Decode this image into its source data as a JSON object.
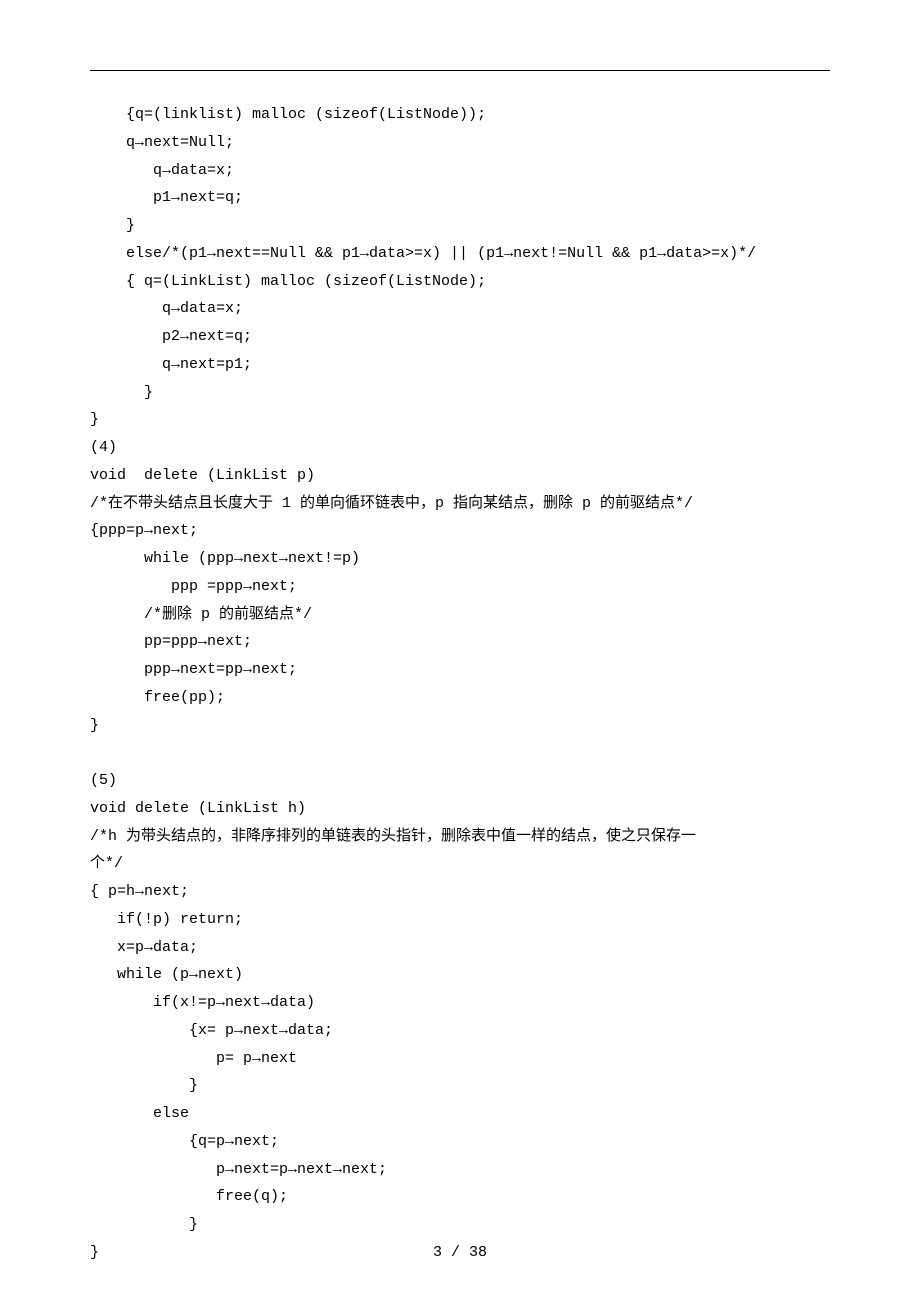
{
  "lines": [
    "    {q=(linklist) malloc (sizeof(ListNode));",
    "    q→next=Null;",
    "       q→data=x;",
    "       p1→next=q;",
    "    }",
    "    else/*(p1→next==Null && p1→data>=x) || (p1→next!=Null && p1→data>=x)*/",
    "    { q=(LinkList) malloc (sizeof(ListNode);",
    "        q→data=x;",
    "        p2→next=q;",
    "        q→next=p1;",
    "      }",
    "}",
    "(4)",
    "void  delete (LinkList p)",
    "/*在不带头结点且长度大于 1 的单向循环链表中，p 指向某结点，删除 p 的前驱结点*/",
    "{ppp=p→next;",
    "      while (ppp→next→next!=p)",
    "         ppp =ppp→next;",
    "      /*删除 p 的前驱结点*/",
    "      pp=ppp→next;",
    "      ppp→next=pp→next;",
    "      free(pp);",
    "}",
    "",
    "(5)",
    "void delete (LinkList h)",
    "/*h 为带头结点的，非降序排列的单链表的头指针，删除表中值一样的结点，使之只保存一",
    "个*/",
    "{ p=h→next;",
    "   if(!p) return;",
    "   x=p→data;",
    "   while (p→next)",
    "       if(x!=p→next→data)",
    "           {x= p→next→data;",
    "              p= p→next",
    "           }",
    "       else",
    "           {q=p→next;",
    "              p→next=p→next→next;",
    "              free(q);",
    "           }",
    "}"
  ],
  "footer": "3 / 38"
}
